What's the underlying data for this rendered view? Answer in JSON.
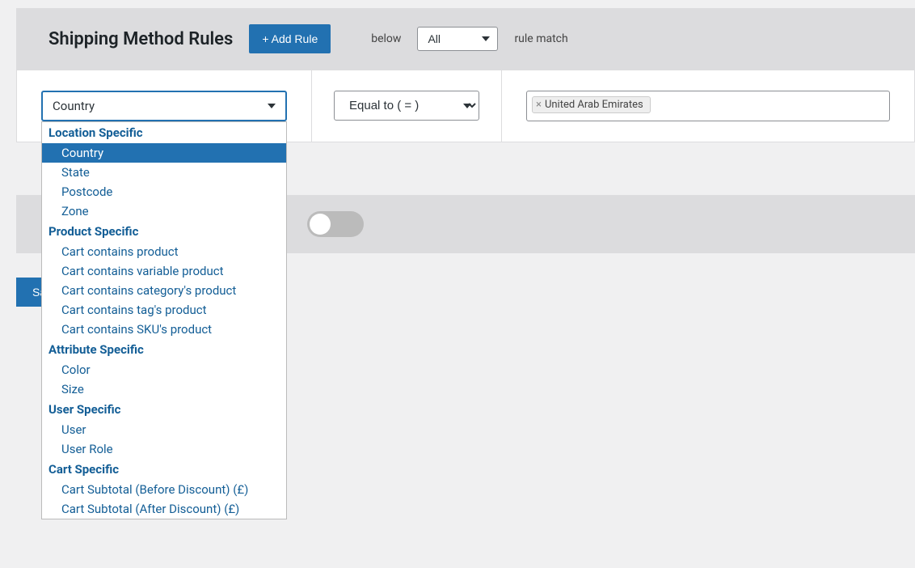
{
  "header": {
    "title": "Shipping Method Rules",
    "add_button": "+ Add Rule",
    "below_label": "below",
    "all_select": "All",
    "rule_match_label": "rule match"
  },
  "rule": {
    "field_value": "Country",
    "operator_value": "Equal to ( = )",
    "tag_value": "United Arab Emirates"
  },
  "dropdown": {
    "groups": [
      {
        "label": "Location Specific",
        "options": [
          "Country",
          "State",
          "Postcode",
          "Zone"
        ]
      },
      {
        "label": "Product Specific",
        "options": [
          "Cart contains product",
          "Cart contains variable product",
          "Cart contains category's product",
          "Cart contains tag's product",
          "Cart contains SKU's product"
        ]
      },
      {
        "label": "Attribute Specific",
        "options": [
          "Color",
          "Size"
        ]
      },
      {
        "label": "User Specific",
        "options": [
          "User",
          "User Role"
        ]
      },
      {
        "label": "Cart Specific",
        "options": [
          "Cart Subtotal (Before Discount) (£)",
          "Cart Subtotal (After Discount) (£)"
        ]
      }
    ],
    "selected": "Country"
  },
  "save_button": "Sa"
}
